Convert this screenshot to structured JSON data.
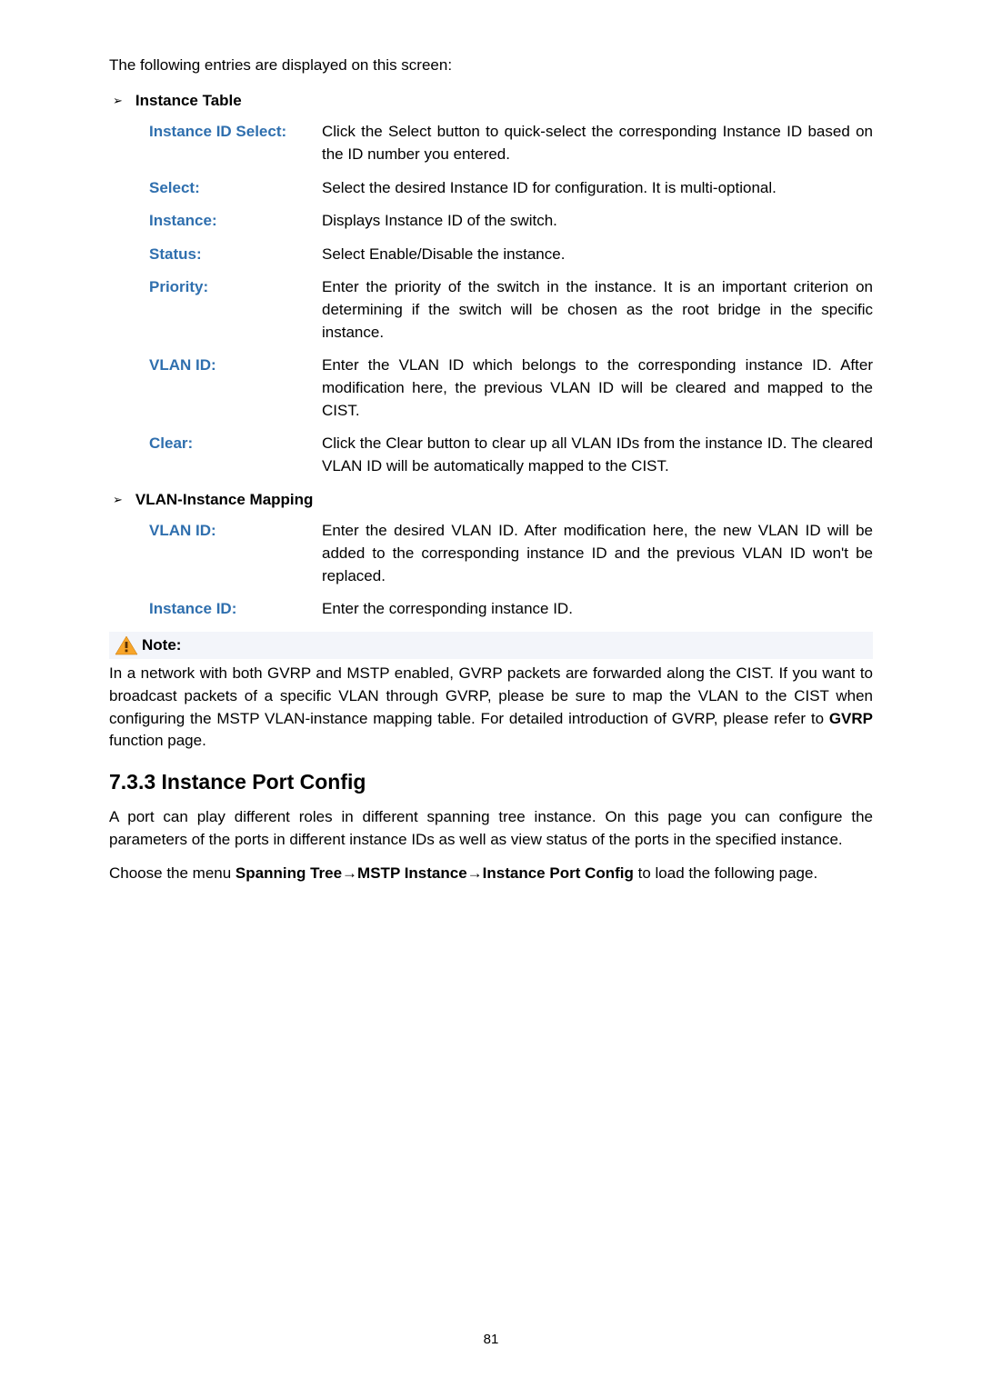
{
  "intro": "The following entries are displayed on this screen:",
  "sections": {
    "instanceTable": {
      "header": "Instance Table",
      "rows": {
        "idselect": {
          "term": "Instance ID Select:",
          "desc": "Click the Select button to quick-select the corresponding Instance ID based on the ID number you entered."
        },
        "select": {
          "term": "Select:",
          "desc": "Select the desired Instance ID for configuration. It is multi-optional."
        },
        "instance": {
          "term": "Instance:",
          "desc": "Displays Instance ID of the switch."
        },
        "status": {
          "term": "Status:",
          "desc": "Select Enable/Disable the instance."
        },
        "priority": {
          "term": "Priority:",
          "desc": "Enter the priority of the switch in the instance. It is an important criterion on determining if the switch will be chosen as the root bridge in the specific instance."
        },
        "vlanid": {
          "term": "VLAN ID:",
          "desc": "Enter the VLAN ID which belongs to the corresponding instance ID. After modification here, the previous VLAN ID will be cleared and mapped to the CIST."
        },
        "clear": {
          "term": "Clear:",
          "desc": "Click the Clear button to clear up all VLAN IDs from the instance ID. The cleared VLAN ID will be automatically mapped to the CIST."
        }
      }
    },
    "vlanMapping": {
      "header": "VLAN-Instance Mapping",
      "rows": {
        "vlanid": {
          "term": "VLAN ID:",
          "desc": "Enter the desired VLAN ID. After modification here, the new VLAN ID will be added to the corresponding instance ID and the previous VLAN ID won't be replaced."
        },
        "instanceid": {
          "term": "Instance ID:",
          "desc": "Enter the corresponding instance ID."
        }
      }
    }
  },
  "note": {
    "label": "Note:",
    "text_pre": "In a network with both GVRP and MSTP enabled, GVRP packets are forwarded along the CIST. If you want to broadcast packets of a specific VLAN through GVRP, please be sure to map the VLAN to the CIST when configuring the MSTP VLAN-instance mapping table. For detailed introduction of GVRP, please refer to ",
    "bold": "GVRP",
    "text_post": " function page."
  },
  "heading": "7.3.3 Instance Port Config",
  "para1": "A port can play different roles in different spanning tree instance. On this page you can configure the parameters of the ports in different instance IDs as well as view status of the ports in the specified instance.",
  "para2_pre": "Choose the menu ",
  "para2_bold": "Spanning Tree→MSTP Instance→Instance Port Config",
  "para2_post": " to load the following page.",
  "pageNum": "81"
}
